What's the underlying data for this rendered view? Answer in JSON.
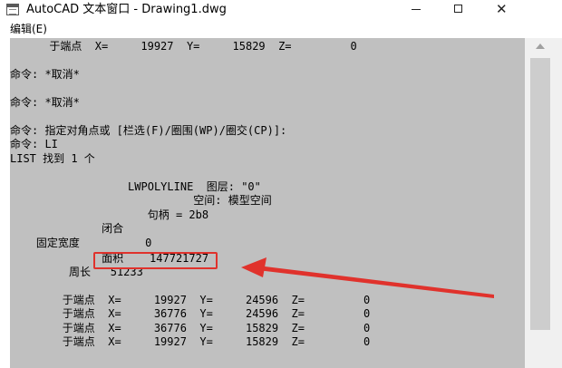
{
  "window": {
    "title": "AutoCAD 文本窗口 - Drawing1.dwg",
    "min_icon": "minimize-icon",
    "max_icon": "maximize-icon",
    "close_icon": "close-icon"
  },
  "menu": {
    "items": [
      "编辑(E)"
    ]
  },
  "console": {
    "lines": [
      "      于端点  X=     19927  Y=     15829  Z=         0",
      "",
      "命令: *取消*",
      "",
      "命令: *取消*",
      "",
      "命令: 指定对角点或 [栏选(F)/圈围(WP)/圈交(CP)]:",
      "命令: LI",
      "LIST 找到 1 个",
      "",
      "                  LWPOLYLINE  图层: \"0\"",
      "                            空间: 模型空间",
      "                     句柄 = 2b8",
      "              闭合",
      "    固定宽度          0",
      "              面积    147721727",
      "         周长   51233",
      "",
      "        于端点  X=     19927  Y=     24596  Z=         0",
      "        于端点  X=     36776  Y=     24596  Z=         0",
      "        于端点  X=     36776  Y=     15829  Z=         0",
      "        于端点  X=     19927  Y=     15829  Z=         0"
    ]
  },
  "annotation": {
    "color": "#e0322c"
  },
  "colors": {
    "console_bg": "#c0c0c0",
    "console_text": "#000000"
  }
}
